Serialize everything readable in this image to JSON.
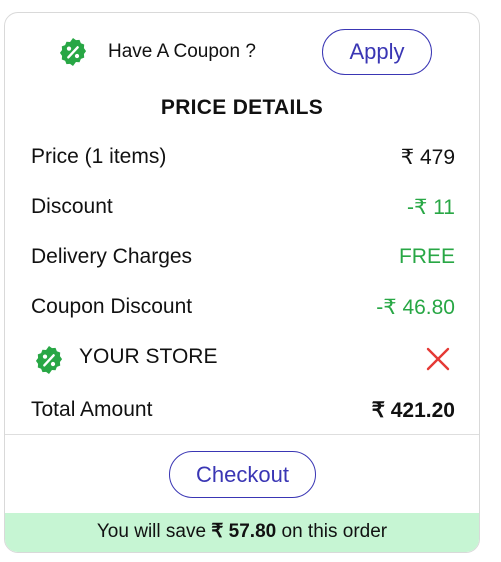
{
  "coupon": {
    "label": "Have A Coupon ?",
    "apply_label": "Apply",
    "icon": "discount-badge-icon"
  },
  "price_details": {
    "title": "PRICE DETAILS",
    "rows": {
      "price": {
        "label": "Price (1 items)",
        "value": "₹ 479"
      },
      "discount": {
        "label": "Discount",
        "value": "-₹ 11"
      },
      "delivery": {
        "label": "Delivery Charges",
        "value": "FREE"
      },
      "coupon_discount": {
        "label": "Coupon Discount",
        "value": "-₹ 46.80"
      }
    },
    "applied_coupon": {
      "label": "YOUR STORE",
      "remove_icon": "close-icon"
    },
    "total": {
      "label": "Total Amount",
      "value": "₹ 421.20"
    }
  },
  "checkout": {
    "label": "Checkout"
  },
  "savings": {
    "prefix": "You will save",
    "amount": "₹ 57.80",
    "suffix": "on this order"
  },
  "colors": {
    "accent": "#3a36b4",
    "green": "#28a745",
    "badge": "#28a745",
    "remove": "#e53935",
    "save_bar_bg": "#c6f5d3"
  }
}
